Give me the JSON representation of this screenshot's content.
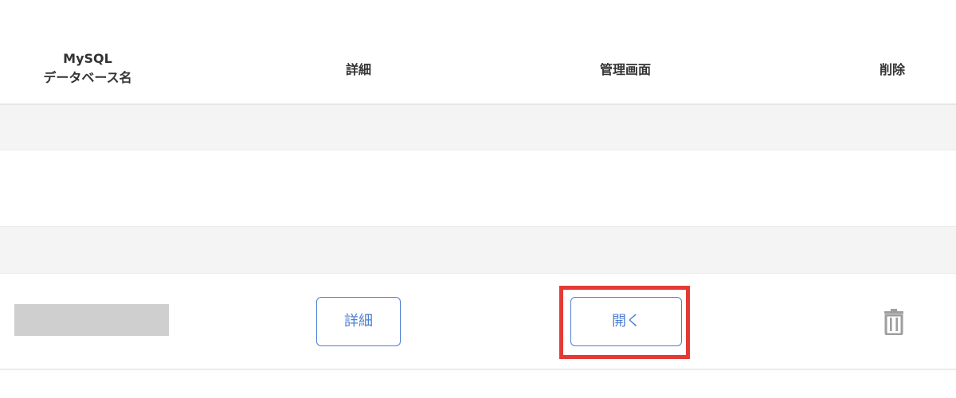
{
  "table": {
    "headers": {
      "db_line1": "MySQL",
      "db_line2": "データベース名",
      "detail": "詳細",
      "admin": "管理画面",
      "delete": "削除"
    },
    "rows": [
      {
        "database_name": "",
        "detail_button": "詳細",
        "admin_button": "開く",
        "delete_icon": "trash-icon"
      }
    ]
  },
  "colors": {
    "accent": "#4f7fd0",
    "highlight": "#e53935",
    "row_alt": "#f4f4f4",
    "redaction": "#cfcfcf"
  }
}
